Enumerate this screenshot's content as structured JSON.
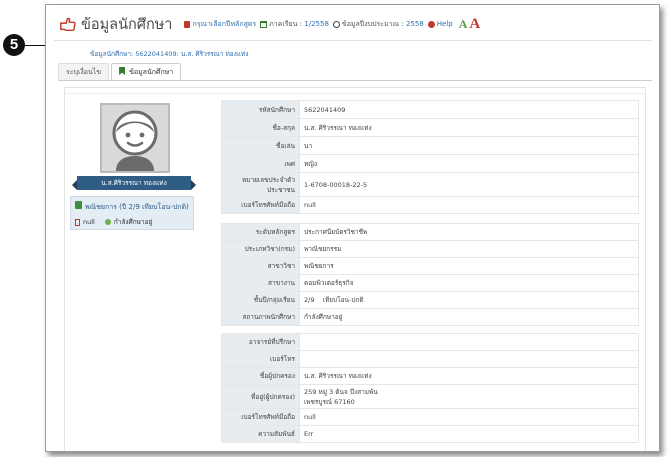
{
  "callout": {
    "number": "5"
  },
  "header": {
    "title": "ข้อมูลนักศึกษา",
    "curriculum_link": "กรุณาเลือกปีหลักสูตร",
    "semester_label": "ภาคเรียน :",
    "semester_value": "1/2558",
    "budget_label": "ข้อมูลปีงบประมาณ :",
    "budget_value": "2558",
    "help_label": "Help",
    "font_small": "A",
    "font_large": "A"
  },
  "breadcrumb": "ข้อมูลนักศึกษา: 5622041409: น.ส. ศิริวรรณา ทองแท่ง",
  "tabs": [
    {
      "label": "ระบุเงื่อนไข"
    },
    {
      "label": "ข้อมูลนักศึกษา"
    }
  ],
  "profile": {
    "name": "น.ส.ศิริวรรณา ทองแท่ง",
    "program": "พณิชยการ (ปี 2/9 เทียบโอน-ปกติ)",
    "doc_status": "null",
    "study_status": "กำลังศึกษาอยู่"
  },
  "section1": [
    {
      "label": "รหัสนักศึกษา",
      "value": "5622041409"
    },
    {
      "label": "ชื่อ-สกุล",
      "value": "น.ส. ศิริวรรณา ทองแท่ง"
    },
    {
      "label": "ชื่อเล่น",
      "value": "นา"
    },
    {
      "label": "เพศ",
      "value": "หญิง"
    },
    {
      "label_line1": "หมายเลขประจำตัว",
      "label_line2": "ประชาชน",
      "value": "1-6708-00018-22-5"
    },
    {
      "label": "เบอร์โทรศัพท์มือถือ",
      "value": "null"
    }
  ],
  "section2": [
    {
      "label": "ระดับหลักสูตร",
      "value": "ประกาศนียบัตรวิชาชีพ"
    },
    {
      "label": "ประเภทวิชา(กรม)",
      "value": "พาณิชยกรรม"
    },
    {
      "label": "สาขาวิชา",
      "value": "พณิชยการ"
    },
    {
      "label": "สาขางาน",
      "value": "คอมพิวเตอร์ธุรกิจ"
    },
    {
      "label": "ชั้นปี/กลุ่มเรียน",
      "value": "2/9    เทียบโอน-ปกติ"
    },
    {
      "label": "สถานภาพนักศึกษา",
      "value": "กำลังศึกษาอยู่"
    }
  ],
  "section3": [
    {
      "label": "อาจารย์ที่ปรึกษา",
      "value": ""
    },
    {
      "label": "เบอร์โทร",
      "value": ""
    },
    {
      "label": "ชื่อผู้ปกครอง",
      "value": "น.ส. ศิริวรรณา ทองแท่ง"
    },
    {
      "label": "ที่อยู่(ผู้ปกครอง)",
      "value_line1": "259 หมู่ 3 ต้นจ บึงสามพัน",
      "value_line2": "เพชรบูรณ์ 67160"
    },
    {
      "label": "เบอร์โทรศัพท์มือถือ",
      "value": "null"
    },
    {
      "label": "ความสัมพันธ์",
      "value": "Err"
    }
  ],
  "colors": {
    "accent_blue": "#2f6fb0",
    "banner_blue": "#2f5d86",
    "title_icon_red": "#c0392b",
    "label_bg": "#e7ecf1",
    "status_green": "#6ab04c"
  },
  "icons": {
    "title": "hand-point-icon",
    "curriculum": "book-icon",
    "semester": "calendar-icon",
    "budget": "clock-icon",
    "help": "question-circle-icon",
    "tab_active": "bookmark-icon",
    "avatar": "user-avatar-icon"
  }
}
